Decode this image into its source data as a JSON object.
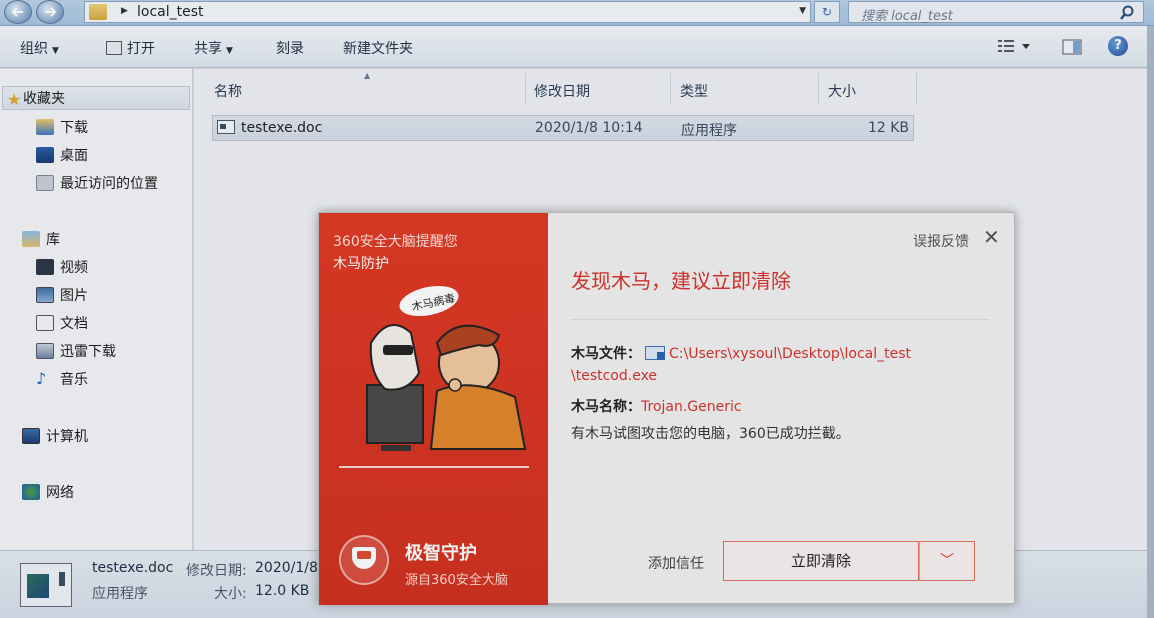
{
  "window": {
    "address_path": "local_test",
    "search_placeholder": "搜索 local_test"
  },
  "toolbar": {
    "organize": "组织",
    "open": "打开",
    "share": "共享",
    "burn": "刻录",
    "new_folder": "新建文件夹"
  },
  "sidebar": {
    "favorites": "收藏夹",
    "items": [
      {
        "label": "下载",
        "icon": "download-folder-icon"
      },
      {
        "label": "桌面",
        "icon": "desktop-icon"
      },
      {
        "label": "最近访问的位置",
        "icon": "recent-places-icon"
      },
      {
        "label": "库",
        "icon": "library-icon"
      },
      {
        "label": "视频",
        "icon": "video-icon"
      },
      {
        "label": "图片",
        "icon": "pictures-icon"
      },
      {
        "label": "文档",
        "icon": "documents-icon"
      },
      {
        "label": "迅雷下载",
        "icon": "xunlei-download-icon"
      },
      {
        "label": "音乐",
        "icon": "music-icon"
      },
      {
        "label": "计算机",
        "icon": "computer-icon"
      },
      {
        "label": "网络",
        "icon": "network-icon"
      }
    ]
  },
  "columns": {
    "name": "名称",
    "modified": "修改日期",
    "type": "类型",
    "size": "大小"
  },
  "files": [
    {
      "name": "testexe.doc",
      "modified": "2020/1/8 10:14",
      "type": "应用程序",
      "size": "12 KB"
    }
  ],
  "details": {
    "filename": "testexe.doc",
    "modified_label": "修改日期:",
    "modified_value": "2020/1/8",
    "type": "应用程序",
    "size_label": "大小:",
    "size_value": "12.0 KB"
  },
  "popup": {
    "brand": "360安全大脑提醒您",
    "subtitle": "木马防护",
    "bubble": "木马病毒",
    "protect_title": "极智守护",
    "protect_sub": "源自360安全大脑",
    "feedback": "误报反馈",
    "close": "✕",
    "headline": "发现木马，建议立即清除",
    "file_label": "木马文件：",
    "file_path_1": "C:\\Users\\xysoul\\Desktop\\local_test",
    "file_path_2": "\\testcod.exe",
    "name_label": "木马名称：",
    "trojan_name": "Trojan.Generic",
    "message": "有木马试图攻击您的电脑，360已成功拦截。",
    "trust": "添加信任",
    "clear_button": "立即清除",
    "accent_color": "#d8322b"
  }
}
